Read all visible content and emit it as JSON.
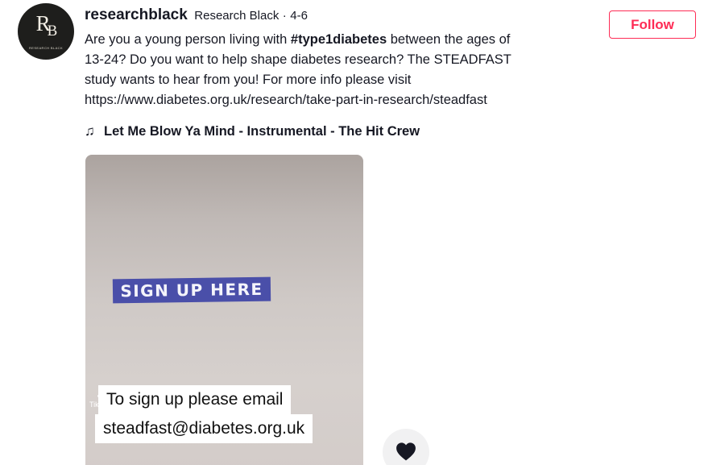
{
  "author": {
    "username": "researchblack",
    "nickname": "Research Black",
    "separator": "·",
    "date": "4-6",
    "avatar": {
      "monogram_r": "R",
      "monogram_b": "B",
      "subtitle": "RESEARCH BLACK"
    }
  },
  "follow_button": {
    "label": "Follow",
    "color": "#fe2c55"
  },
  "caption": {
    "line1_prefix": "Are you a young person living with ",
    "hashtag": "#type1diabetes",
    "line1_suffix": " between the ages of",
    "line2": "13-24? Do you want to help shape diabetes research? The STEADFAST",
    "line3": "study wants to hear from you!  For more info please visit",
    "line4": "https://www.diabetes.org.uk/research/take-part-in-research/steadfast"
  },
  "music": {
    "icon": "music-note-icon",
    "title": "Let Me Blow Ya Mind - Instrumental - The Hit Crew"
  },
  "video": {
    "banner_text": "SIGN UP HERE",
    "banner_color": "#4a4fa9",
    "overlay_line1": "To sign up please email",
    "overlay_line2": "steadfast@diabetes.org.uk",
    "watermark": "TikTok"
  },
  "actions": {
    "like_icon": "heart-icon"
  }
}
